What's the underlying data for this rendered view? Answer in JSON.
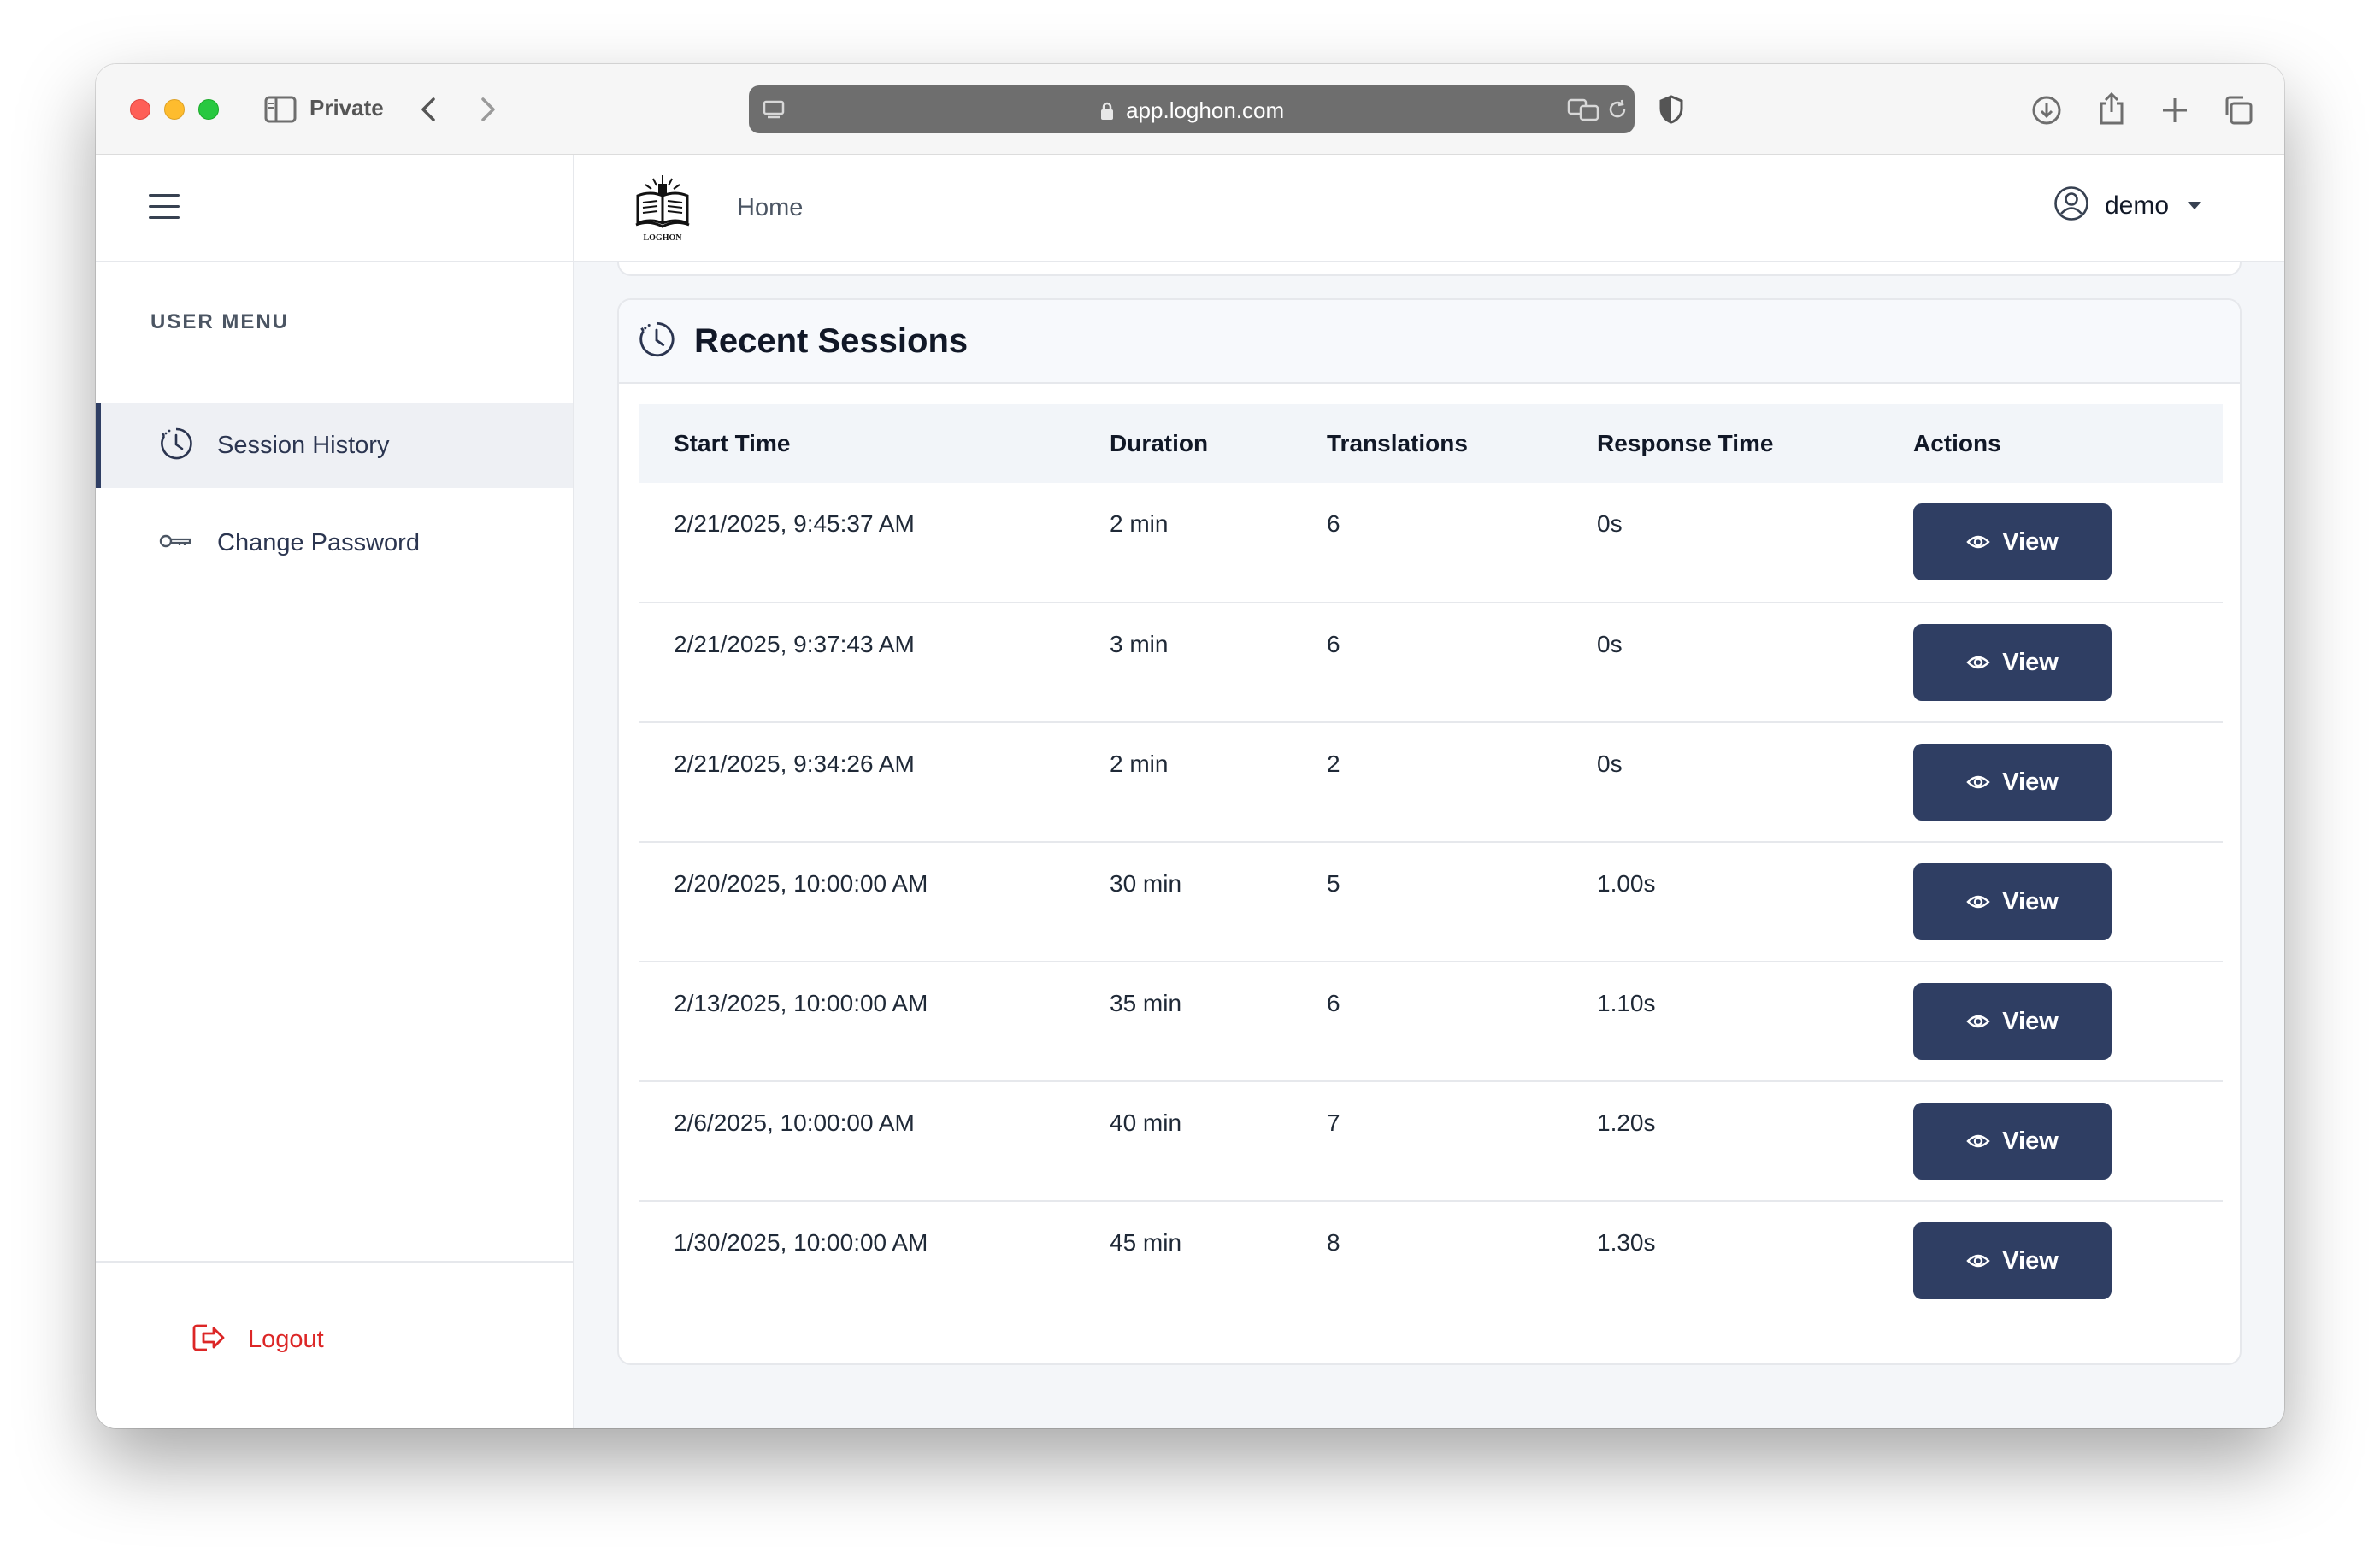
{
  "browser": {
    "private_label": "Private",
    "url": "app.loghon.com"
  },
  "brand": {
    "logo_text": "LOGHON",
    "accent_color": "#2f3e63",
    "logout_color": "#dc2626"
  },
  "sidebar": {
    "menu_title": "USER MENU",
    "items": [
      {
        "label": "Session History",
        "icon": "clock-icon",
        "active": true
      },
      {
        "label": "Change Password",
        "icon": "key-icon",
        "active": false
      }
    ],
    "logout_label": "Logout"
  },
  "header": {
    "home_label": "Home",
    "user_name": "demo"
  },
  "sessions": {
    "title": "Recent Sessions",
    "columns": [
      "Start Time",
      "Duration",
      "Translations",
      "Response Time",
      "Actions"
    ],
    "view_label": "View",
    "rows": [
      {
        "start": "2/21/2025, 9:45:37 AM",
        "duration": "2 min",
        "translations": "6",
        "response": "0s"
      },
      {
        "start": "2/21/2025, 9:37:43 AM",
        "duration": "3 min",
        "translations": "6",
        "response": "0s"
      },
      {
        "start": "2/21/2025, 9:34:26 AM",
        "duration": "2 min",
        "translations": "2",
        "response": "0s"
      },
      {
        "start": "2/20/2025, 10:00:00 AM",
        "duration": "30 min",
        "translations": "5",
        "response": "1.00s"
      },
      {
        "start": "2/13/2025, 10:00:00 AM",
        "duration": "35 min",
        "translations": "6",
        "response": "1.10s"
      },
      {
        "start": "2/6/2025, 10:00:00 AM",
        "duration": "40 min",
        "translations": "7",
        "response": "1.20s"
      },
      {
        "start": "1/30/2025, 10:00:00 AM",
        "duration": "45 min",
        "translations": "8",
        "response": "1.30s"
      }
    ]
  }
}
